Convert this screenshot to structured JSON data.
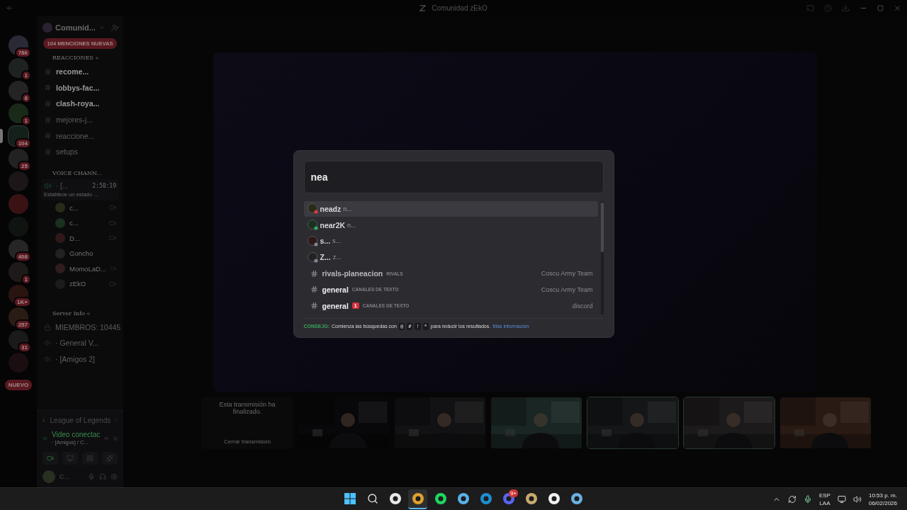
{
  "window": {
    "title": "Comunidad zEkO"
  },
  "servers": [
    {
      "badge": "786",
      "selected": false
    },
    {
      "badge": "1",
      "selected": false
    },
    {
      "badge": "8",
      "selected": false
    },
    {
      "badge": "1",
      "selected": false
    },
    {
      "badge": "104",
      "selected": true
    },
    {
      "badge": "25",
      "selected": false
    },
    {
      "selected": false
    },
    {
      "selected": false
    },
    {
      "selected": false
    },
    {
      "badge": "408",
      "selected": false
    },
    {
      "badge": "1",
      "selected": false
    },
    {
      "badge": "1K+",
      "selected": false
    },
    {
      "badge": "257",
      "selected": false
    },
    {
      "badge": "31",
      "selected": false
    },
    {
      "selected": false
    }
  ],
  "new_badge": "NUEVO",
  "sidebar": {
    "server_name": "Comunid...",
    "mentions_banner": "104 MENCIONES NUEVAS",
    "text_category": {
      "name": "REACCIONES «",
      "channels": [
        {
          "name": "recome...",
          "unread": true
        },
        {
          "name": "lobbys-fac...",
          "unread": true
        },
        {
          "name": "clash-roya...",
          "unread": true
        },
        {
          "name": "mejores-j...",
          "unread": false
        },
        {
          "name": "reaccione...",
          "unread": false
        },
        {
          "name": "setups",
          "unread": false
        }
      ]
    },
    "voice_category": {
      "name": "VOICE CHANN...",
      "channel": {
        "name": "· [...",
        "timer": "2:50:19",
        "status": "Establece un estado ..."
      },
      "members": [
        {
          "name": "c...",
          "video": true
        },
        {
          "name": "c...",
          "video": true
        },
        {
          "name": "D...",
          "video": true
        },
        {
          "name": "Goncho",
          "video": false
        },
        {
          "name": "MomoLaD...",
          "video": true
        },
        {
          "name": "zEkO",
          "video": true
        }
      ]
    },
    "info_category": {
      "name": "Server Info «",
      "items": [
        {
          "kind": "locked",
          "name": "MIEMBROS: 10445"
        },
        {
          "kind": "voice",
          "name": "· General V..."
        },
        {
          "kind": "voice",
          "name": "· [Amigos 2]"
        }
      ]
    },
    "activity": {
      "game": "League of Legends",
      "connection": "Video conectac",
      "location": "· [Amigos] / C..."
    },
    "user": {
      "name": "C..."
    }
  },
  "streams": [
    {
      "kind": "ended",
      "message": "Esta transmisión ha finalizado.",
      "action": "Cerrar transmisión"
    },
    {
      "kind": "video",
      "speaking": false
    },
    {
      "kind": "video",
      "speaking": false
    },
    {
      "kind": "video",
      "speaking": false
    },
    {
      "kind": "video",
      "speaking": true
    },
    {
      "kind": "video",
      "speaking": true
    },
    {
      "kind": "video",
      "speaking": false
    }
  ],
  "switcher": {
    "query": "nea",
    "results": [
      {
        "kind": "user",
        "name": "neadz",
        "sub": "n...",
        "color": "#d83c3e",
        "selected": true
      },
      {
        "kind": "user",
        "name": "near2K",
        "sub": "n...",
        "color": "#3ba55d",
        "selected": false
      },
      {
        "kind": "user",
        "name": "s...",
        "sub": "s...",
        "color": "#80848e",
        "selected": false
      },
      {
        "kind": "user",
        "name": "Z...",
        "sub": "z...",
        "color": "#80848e",
        "selected": false
      },
      {
        "kind": "channel",
        "name": "rivals-planeacion",
        "category": "RIVALS",
        "server": "Coscu Army Team",
        "unread": false,
        "selected": false
      },
      {
        "kind": "channel",
        "name": "general",
        "category": "CANALES DE TEXTO",
        "server": "Coscu Army Team",
        "unread": true,
        "selected": false
      },
      {
        "kind": "channel",
        "name": "general",
        "badge": "1",
        "category": "CANALES DE TEXTO",
        "server": "discord",
        "unread": true,
        "selected": false
      }
    ],
    "tip": {
      "label": "CONSEJO:",
      "text": "Comienza las búsquedas con",
      "keys": [
        "@",
        "#",
        "!",
        "*"
      ],
      "after": "para reducir los resultados.",
      "link": "Más información"
    }
  },
  "taskbar": {
    "apps": [
      {
        "kind": "start",
        "active": false
      },
      {
        "kind": "search",
        "active": false
      },
      {
        "kind": "obs",
        "active": false
      },
      {
        "kind": "chrome",
        "active": true
      },
      {
        "kind": "spotify",
        "active": false
      },
      {
        "kind": "notepad",
        "active": false
      },
      {
        "kind": "edge",
        "active": false
      },
      {
        "kind": "discord",
        "active": false,
        "badge": "9+"
      },
      {
        "kind": "league",
        "active": false
      },
      {
        "kind": "skull",
        "active": false
      },
      {
        "kind": "steam",
        "active": false
      }
    ],
    "language": "ESP",
    "region": "LAA",
    "time": "10:53 p. m.",
    "date": "06/02/2026"
  }
}
